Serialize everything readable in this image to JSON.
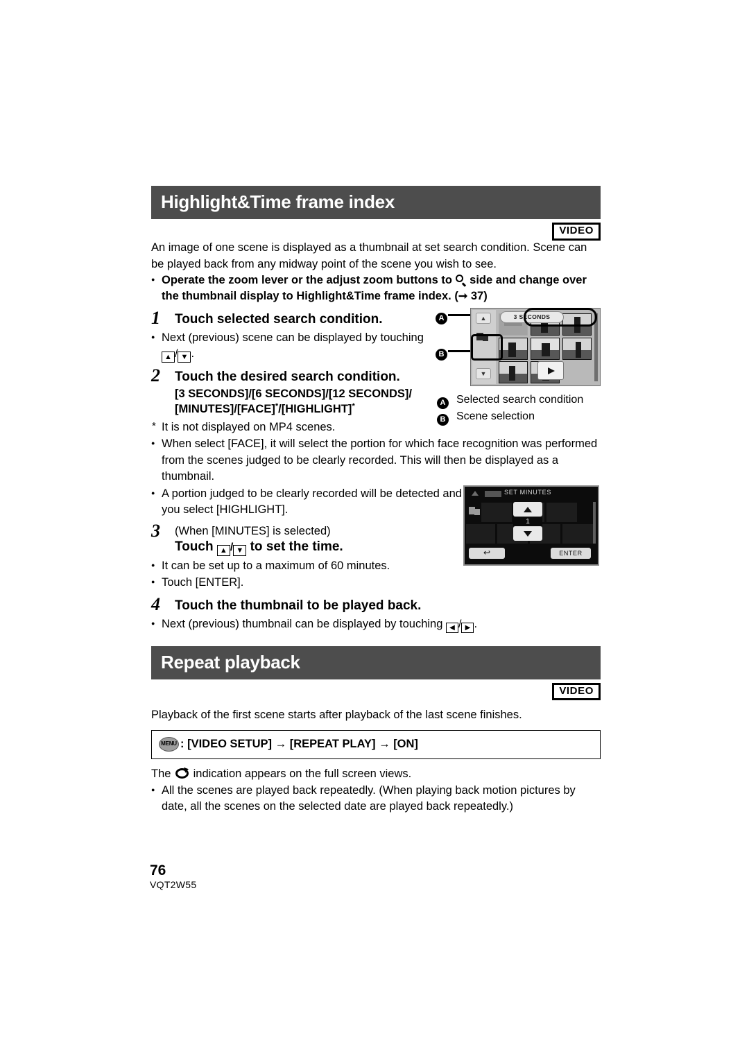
{
  "page": {
    "number": "76",
    "doc_code": "VQT2W55",
    "accent_bar_color": "#4d4d4d"
  },
  "sections": [
    {
      "id": "highlight-time-frame-index",
      "heading": "Highlight&Time frame index",
      "badge": "VIDEO",
      "intro": "An image of one scene is displayed as a thumbnail at set search condition. Scene can be played back from any midway point of the scene you wish to see.",
      "intro_bullet_pre": "Operate the zoom lever or the adjust zoom buttons to",
      "intro_bullet_post": "side and change over the thumbnail display to Highlight&Time frame index. (",
      "intro_bullet_ref": "37",
      "intro_bullet_close": ")",
      "steps": [
        {
          "num": "1",
          "title": "Touch selected search condition.",
          "bullet_pre": "Next (previous) scene can be displayed by touching",
          "bullet_post": "."
        },
        {
          "num": "2",
          "title": "Touch the desired search condition.",
          "options_line1": "[3 SECONDS]/[6 SECONDS]/[12 SECONDS]/",
          "options_line2_a": "[MINUTES]/[FACE]",
          "options_line2_b": "/[HIGHLIGHT]",
          "star": "*"
        },
        {
          "num": "3",
          "condition": "(When [MINUTES] is selected)",
          "title_pre": "Touch",
          "title_post": "to set the time.",
          "bullets": [
            "It can be set up to a maximum of 60 minutes.",
            "Touch [ENTER]."
          ]
        },
        {
          "num": "4",
          "title": "Touch the thumbnail to be played back.",
          "bullet_pre": "Next (previous) thumbnail can be displayed by touching",
          "bullet_post": "."
        }
      ],
      "notes": [
        {
          "marker": "*",
          "text": "It is not displayed on MP4 scenes."
        },
        {
          "marker": "bullet",
          "text": "When select [FACE], it will select the portion for which face recognition was performed from the scenes judged to be clearly recorded. This will then be displayed as a thumbnail."
        },
        {
          "marker": "bullet",
          "text": "A portion judged to be clearly recorded will be detected and displayed in thumbnail if you select [HIGHLIGHT]."
        }
      ],
      "figure1": {
        "callout_a": "A",
        "callout_b": "B",
        "screen_condition_label": "3 SECONDS",
        "legend": [
          {
            "key": "A",
            "text": "Selected search condition"
          },
          {
            "key": "B",
            "text": "Scene selection"
          }
        ]
      },
      "figure2": {
        "screen_title": "SET MINUTES",
        "value": "1",
        "enter_label": "ENTER",
        "back_label": "↩"
      }
    },
    {
      "id": "repeat-playback",
      "heading": "Repeat playback",
      "badge": "VIDEO",
      "intro": "Playback of the first scene starts after playback of the last scene finishes.",
      "menu_path": {
        "menu_glyph_label": "MENU",
        "prefix": ":",
        "items": [
          "[VIDEO SETUP]",
          "[REPEAT PLAY]",
          "[ON]"
        ],
        "separator": "→"
      },
      "after_menu_pre": "The",
      "after_menu_post": "indication appears on the full screen views.",
      "notes": [
        {
          "marker": "bullet",
          "text": "All the scenes are played back repeatedly. (When playing back motion pictures by date, all the scenes on the selected date are played back repeatedly.)"
        }
      ]
    }
  ]
}
